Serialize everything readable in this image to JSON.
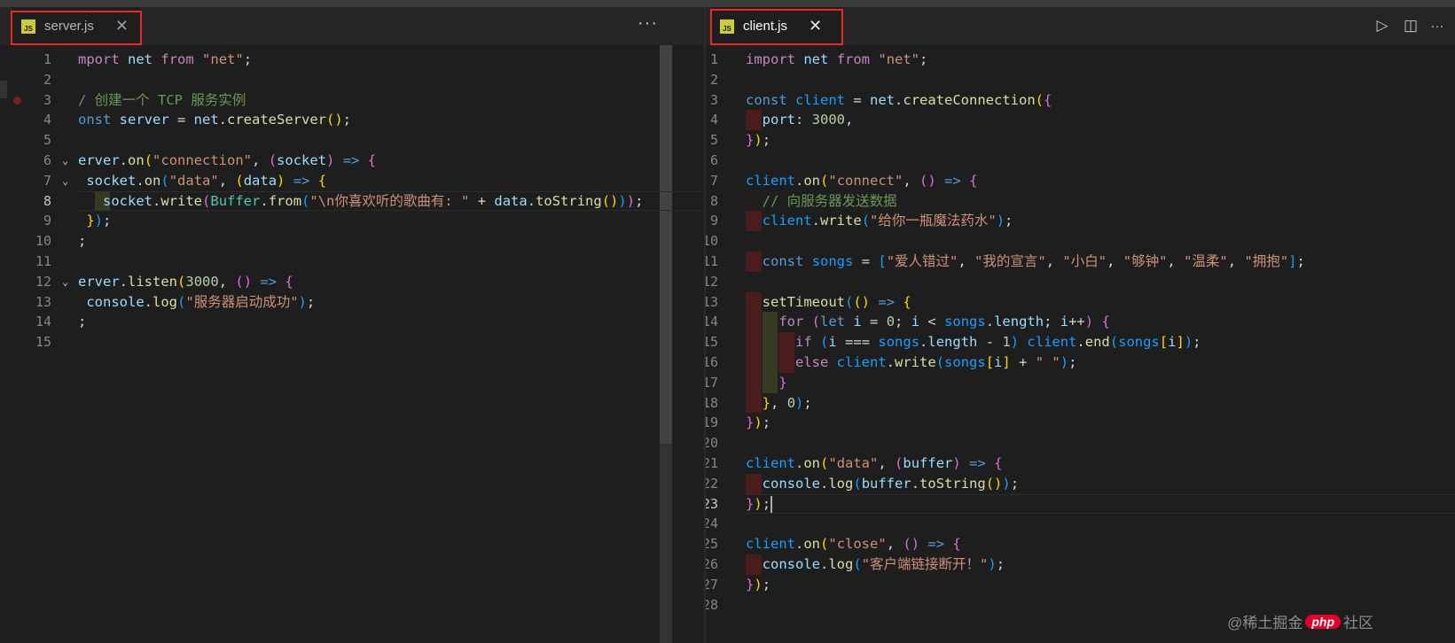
{
  "left_tab": {
    "name": "server.js",
    "icon": "js-file-icon",
    "close": "✕"
  },
  "right_tab": {
    "name": "client.js",
    "icon": "js-file-icon",
    "close": "✕"
  },
  "left_actions": {
    "more": "···"
  },
  "right_actions": {
    "run": "▷",
    "split": "◫",
    "more": "···"
  },
  "server_lines": [
    [
      [
        "k",
        "mport"
      ],
      [
        "d",
        " "
      ],
      [
        "v",
        "net"
      ],
      [
        "d",
        " "
      ],
      [
        "k",
        "from"
      ],
      [
        "d",
        " "
      ],
      [
        "s",
        "\"net\""
      ],
      [
        "d",
        ";"
      ]
    ],
    [],
    [
      [
        "c",
        "/ 创建一个 TCP 服务实例"
      ]
    ],
    [
      [
        "b",
        "onst"
      ],
      [
        "d",
        " "
      ],
      [
        "v",
        "server"
      ],
      [
        "d",
        " = "
      ],
      [
        "v",
        "net"
      ],
      [
        "d",
        "."
      ],
      [
        "f",
        "createServer"
      ],
      [
        "y",
        "()"
      ],
      [
        "d",
        ";"
      ]
    ],
    [],
    [
      [
        "v",
        "erver"
      ],
      [
        "d",
        "."
      ],
      [
        "f",
        "on"
      ],
      [
        "y",
        "("
      ],
      [
        "s",
        "\"connection\""
      ],
      [
        "d",
        ", "
      ],
      [
        "m",
        "("
      ],
      [
        "v",
        "socket"
      ],
      [
        "m",
        ")"
      ],
      [
        "d",
        " "
      ],
      [
        "b",
        "=>"
      ],
      [
        "d",
        " "
      ],
      [
        "m",
        "{"
      ]
    ],
    [
      [
        "d",
        " "
      ],
      [
        "v",
        "socket"
      ],
      [
        "d",
        "."
      ],
      [
        "f",
        "on"
      ],
      [
        "bl",
        "("
      ],
      [
        "s",
        "\"data\""
      ],
      [
        "d",
        ", "
      ],
      [
        "y",
        "("
      ],
      [
        "v",
        "data"
      ],
      [
        "y",
        ")"
      ],
      [
        "d",
        " "
      ],
      [
        "b",
        "=>"
      ],
      [
        "d",
        " "
      ],
      [
        "y",
        "{"
      ]
    ],
    [
      [
        "d",
        "   "
      ],
      [
        "v",
        "socket"
      ],
      [
        "d",
        "."
      ],
      [
        "f",
        "write"
      ],
      [
        "m",
        "("
      ],
      [
        "t",
        "Buffer"
      ],
      [
        "d",
        "."
      ],
      [
        "f",
        "from"
      ],
      [
        "bl",
        "("
      ],
      [
        "s",
        "\"\\n你喜欢听的歌曲有: \""
      ],
      [
        "d",
        " + "
      ],
      [
        "v",
        "data"
      ],
      [
        "d",
        "."
      ],
      [
        "f",
        "toString"
      ],
      [
        "y",
        "()"
      ],
      [
        "bl",
        ")"
      ],
      [
        "m",
        ")"
      ],
      [
        "d",
        ";"
      ]
    ],
    [
      [
        "d",
        " "
      ],
      [
        "y",
        "}"
      ],
      [
        "bl",
        ")"
      ],
      [
        "d",
        ";"
      ]
    ],
    [
      [
        "m",
        ""
      ],
      [
        "d",
        ";"
      ]
    ],
    [],
    [
      [
        "v",
        "erver"
      ],
      [
        "d",
        "."
      ],
      [
        "f",
        "listen"
      ],
      [
        "y",
        "("
      ],
      [
        "n",
        "3000"
      ],
      [
        "d",
        ", "
      ],
      [
        "m",
        "()"
      ],
      [
        "d",
        " "
      ],
      [
        "b",
        "=>"
      ],
      [
        "d",
        " "
      ],
      [
        "m",
        "{"
      ]
    ],
    [
      [
        "d",
        " "
      ],
      [
        "v",
        "console"
      ],
      [
        "d",
        "."
      ],
      [
        "f",
        "log"
      ],
      [
        "bl",
        "("
      ],
      [
        "s",
        "\"服务器启动成功\""
      ],
      [
        "bl",
        ")"
      ],
      [
        "d",
        ";"
      ]
    ],
    [
      [
        "d",
        ";"
      ]
    ],
    []
  ],
  "client_lines": [
    [
      [
        "k",
        "import"
      ],
      [
        "d",
        " "
      ],
      [
        "v",
        "net"
      ],
      [
        "d",
        " "
      ],
      [
        "k",
        "from"
      ],
      [
        "d",
        " "
      ],
      [
        "s",
        "\"net\""
      ],
      [
        "d",
        ";"
      ]
    ],
    [],
    [
      [
        "b",
        "const"
      ],
      [
        "d",
        " "
      ],
      [
        "bl",
        "client"
      ],
      [
        "d",
        " = "
      ],
      [
        "v",
        "net"
      ],
      [
        "d",
        "."
      ],
      [
        "f",
        "createConnection"
      ],
      [
        "y",
        "("
      ],
      [
        "m",
        "{"
      ]
    ],
    [
      [
        "d",
        "  "
      ],
      [
        "v",
        "port"
      ],
      [
        "d",
        ": "
      ],
      [
        "n",
        "3000"
      ],
      [
        "d",
        ","
      ]
    ],
    [
      [
        "m",
        "}"
      ],
      [
        "y",
        ")"
      ],
      [
        "d",
        ";"
      ]
    ],
    [],
    [
      [
        "bl",
        "client"
      ],
      [
        "d",
        "."
      ],
      [
        "f",
        "on"
      ],
      [
        "y",
        "("
      ],
      [
        "s",
        "\"connect\""
      ],
      [
        "d",
        ", "
      ],
      [
        "m",
        "()"
      ],
      [
        "d",
        " "
      ],
      [
        "b",
        "=>"
      ],
      [
        "d",
        " "
      ],
      [
        "m",
        "{"
      ]
    ],
    [
      [
        "d",
        "  "
      ],
      [
        "c",
        "// 向服务器发送数据"
      ]
    ],
    [
      [
        "d",
        "  "
      ],
      [
        "bl",
        "client"
      ],
      [
        "d",
        "."
      ],
      [
        "f",
        "write"
      ],
      [
        "bl",
        "("
      ],
      [
        "s",
        "\"给你一瓶魔法药水\""
      ],
      [
        "bl",
        ")"
      ],
      [
        "d",
        ";"
      ]
    ],
    [],
    [
      [
        "d",
        "  "
      ],
      [
        "b",
        "const"
      ],
      [
        "d",
        " "
      ],
      [
        "bl",
        "songs"
      ],
      [
        "d",
        " = "
      ],
      [
        "bl",
        "["
      ],
      [
        "s",
        "\"爱人错过\""
      ],
      [
        "d",
        ", "
      ],
      [
        "s",
        "\"我的宣言\""
      ],
      [
        "d",
        ", "
      ],
      [
        "s",
        "\"小白\""
      ],
      [
        "d",
        ", "
      ],
      [
        "s",
        "\"够钟\""
      ],
      [
        "d",
        ", "
      ],
      [
        "s",
        "\"温柔\""
      ],
      [
        "d",
        ", "
      ],
      [
        "s",
        "\"拥抱\""
      ],
      [
        "bl",
        "]"
      ],
      [
        "d",
        ";"
      ]
    ],
    [],
    [
      [
        "d",
        "  "
      ],
      [
        "f",
        "setTimeout"
      ],
      [
        "bl",
        "("
      ],
      [
        "y",
        "()"
      ],
      [
        "d",
        " "
      ],
      [
        "b",
        "=>"
      ],
      [
        "d",
        " "
      ],
      [
        "y",
        "{"
      ]
    ],
    [
      [
        "d",
        "    "
      ],
      [
        "k",
        "for"
      ],
      [
        "d",
        " "
      ],
      [
        "m",
        "("
      ],
      [
        "b",
        "let"
      ],
      [
        "d",
        " "
      ],
      [
        "v",
        "i"
      ],
      [
        "d",
        " = "
      ],
      [
        "n",
        "0"
      ],
      [
        "d",
        "; "
      ],
      [
        "v",
        "i"
      ],
      [
        "d",
        " < "
      ],
      [
        "bl",
        "songs"
      ],
      [
        "d",
        "."
      ],
      [
        "v",
        "length"
      ],
      [
        "d",
        "; "
      ],
      [
        "v",
        "i"
      ],
      [
        "d",
        "++"
      ],
      [
        "m",
        ")"
      ],
      [
        "d",
        " "
      ],
      [
        "m",
        "{"
      ]
    ],
    [
      [
        "d",
        "      "
      ],
      [
        "k",
        "if"
      ],
      [
        "d",
        " "
      ],
      [
        "bl",
        "("
      ],
      [
        "v",
        "i"
      ],
      [
        "d",
        " === "
      ],
      [
        "bl",
        "songs"
      ],
      [
        "d",
        "."
      ],
      [
        "v",
        "length"
      ],
      [
        "d",
        " - "
      ],
      [
        "n",
        "1"
      ],
      [
        "bl",
        ")"
      ],
      [
        "d",
        " "
      ],
      [
        "bl",
        "client"
      ],
      [
        "d",
        "."
      ],
      [
        "f",
        "end"
      ],
      [
        "bl",
        "("
      ],
      [
        "bl",
        "songs"
      ],
      [
        "y",
        "["
      ],
      [
        "v",
        "i"
      ],
      [
        "y",
        "]"
      ],
      [
        "bl",
        ")"
      ],
      [
        "d",
        ";"
      ]
    ],
    [
      [
        "d",
        "      "
      ],
      [
        "k",
        "else"
      ],
      [
        "d",
        " "
      ],
      [
        "bl",
        "client"
      ],
      [
        "d",
        "."
      ],
      [
        "f",
        "write"
      ],
      [
        "bl",
        "("
      ],
      [
        "bl",
        "songs"
      ],
      [
        "y",
        "["
      ],
      [
        "v",
        "i"
      ],
      [
        "y",
        "]"
      ],
      [
        "d",
        " + "
      ],
      [
        "s",
        "\" \""
      ],
      [
        "bl",
        ")"
      ],
      [
        "d",
        ";"
      ]
    ],
    [
      [
        "d",
        "    "
      ],
      [
        "m",
        "}"
      ]
    ],
    [
      [
        "d",
        "  "
      ],
      [
        "y",
        "}"
      ],
      [
        "d",
        ", "
      ],
      [
        "n",
        "0"
      ],
      [
        "bl",
        ")"
      ],
      [
        "d",
        ";"
      ]
    ],
    [
      [
        "m",
        "}"
      ],
      [
        "y",
        ")"
      ],
      [
        "d",
        ";"
      ]
    ],
    [],
    [
      [
        "bl",
        "client"
      ],
      [
        "d",
        "."
      ],
      [
        "f",
        "on"
      ],
      [
        "y",
        "("
      ],
      [
        "s",
        "\"data\""
      ],
      [
        "d",
        ", "
      ],
      [
        "m",
        "("
      ],
      [
        "v",
        "buffer"
      ],
      [
        "m",
        ")"
      ],
      [
        "d",
        " "
      ],
      [
        "b",
        "=>"
      ],
      [
        "d",
        " "
      ],
      [
        "m",
        "{"
      ]
    ],
    [
      [
        "d",
        "  "
      ],
      [
        "v",
        "console"
      ],
      [
        "d",
        "."
      ],
      [
        "f",
        "log"
      ],
      [
        "bl",
        "("
      ],
      [
        "v",
        "buffer"
      ],
      [
        "d",
        "."
      ],
      [
        "f",
        "toString"
      ],
      [
        "y",
        "()"
      ],
      [
        "bl",
        ")"
      ],
      [
        "d",
        ";"
      ]
    ],
    [
      [
        "m",
        "}"
      ],
      [
        "y",
        ")"
      ],
      [
        "d",
        ";"
      ]
    ],
    [],
    [
      [
        "bl",
        "client"
      ],
      [
        "d",
        "."
      ],
      [
        "f",
        "on"
      ],
      [
        "y",
        "("
      ],
      [
        "s",
        "\"close\""
      ],
      [
        "d",
        ", "
      ],
      [
        "m",
        "()"
      ],
      [
        "d",
        " "
      ],
      [
        "b",
        "=>"
      ],
      [
        "d",
        " "
      ],
      [
        "m",
        "{"
      ]
    ],
    [
      [
        "d",
        "  "
      ],
      [
        "v",
        "console"
      ],
      [
        "d",
        "."
      ],
      [
        "f",
        "log"
      ],
      [
        "bl",
        "("
      ],
      [
        "s",
        "\"客户端链接断开！\""
      ],
      [
        "bl",
        ")"
      ],
      [
        "d",
        ";"
      ]
    ],
    [
      [
        "m",
        "}"
      ],
      [
        "y",
        ")"
      ],
      [
        "d",
        ";"
      ]
    ],
    []
  ],
  "server_active_line": 8,
  "client_active_line": 23,
  "watermark": {
    "prefix": "@稀土掘金",
    "badge": "php",
    "suffix": "社区"
  },
  "colors": {
    "accent_red": "#e8262b",
    "editor_bg": "#1e1e1e",
    "tab_bg": "#1e1e1e",
    "js_icon": "#cbcb41"
  }
}
